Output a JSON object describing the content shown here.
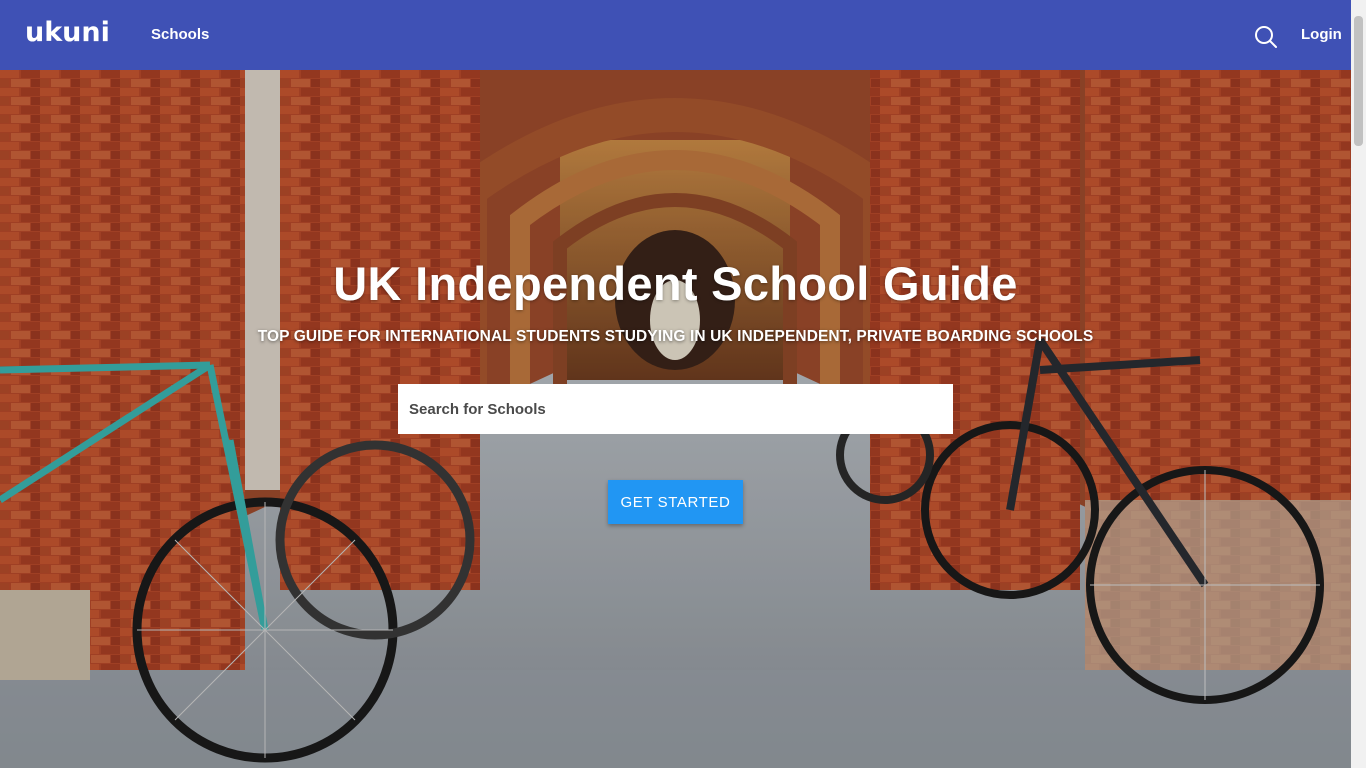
{
  "header": {
    "logo_text": "ukuni",
    "nav_schools": "Schools",
    "login": "Login",
    "brand_color": "#3f51b5"
  },
  "hero": {
    "title": "UK Independent School Guide",
    "subtitle": "TOP GUIDE FOR INTERNATIONAL STUDENTS STUDYING IN UK INDEPENDENT, PRIVATE BOARDING SCHOOLS",
    "search_placeholder": "Search for Schools",
    "cta_label": "GET STARTED",
    "cta_color": "#2196f3",
    "background_image": "brick-arcade-with-bicycles"
  },
  "icons": {
    "search": "search-icon"
  }
}
